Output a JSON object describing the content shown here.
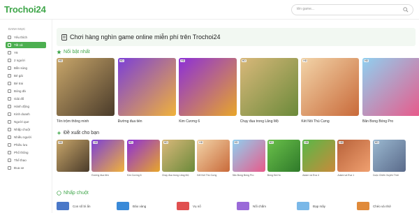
{
  "header": {
    "logo": "Trochoi24",
    "search_placeholder": "tên game..."
  },
  "sidebar": {
    "title": "DANH MỤC",
    "items": [
      {
        "label": "Yêu thích",
        "active": false
      },
      {
        "label": "Tất cả",
        "active": true
      },
      {
        "label": "Y8",
        "active": false
      },
      {
        "label": "2 người",
        "active": false
      },
      {
        "label": "Bắn súng",
        "active": false
      },
      {
        "label": "Bé gái",
        "active": false
      },
      {
        "label": "Bé trai",
        "active": false
      },
      {
        "label": "Bóng đá",
        "active": false
      },
      {
        "label": "Giải đố",
        "active": false
      },
      {
        "label": "Hành động",
        "active": false
      },
      {
        "label": "Kinh doanh",
        "active": false
      },
      {
        "label": "Người que",
        "active": false
      },
      {
        "label": "Nhấp chuột",
        "active": false
      },
      {
        "label": "Nhiều người",
        "active": false
      },
      {
        "label": "Phiêu lưu",
        "active": false
      },
      {
        "label": "Phổ thông",
        "active": false
      },
      {
        "label": "Thể thao",
        "active": false
      },
      {
        "label": "Đua xe",
        "active": false
      }
    ]
  },
  "banner": {
    "text": "Chơi hàng nghìn game online miễn phí trên Trochoi24"
  },
  "featured": {
    "title": "Nổi bật nhất",
    "games": [
      {
        "name": "Tên trộm thông minh",
        "tag": "HD",
        "colors": [
          "#c8a66a",
          "#4a3b2a"
        ]
      },
      {
        "name": "Đường đua tiền",
        "tag": "HD",
        "colors": [
          "#7b3fd8",
          "#f0b23a"
        ]
      },
      {
        "name": "Kim Cương 6",
        "tag": "HD",
        "colors": [
          "#8c2fd8",
          "#e8a62a"
        ]
      },
      {
        "name": "Chạy đua trong Lăng Mộ",
        "tag": "HD",
        "colors": [
          "#d9b87a",
          "#6b8a3a"
        ]
      },
      {
        "name": "Kết Nối Thú Cưng",
        "tag": "HD",
        "colors": [
          "#f2d4a8",
          "#c96a3a"
        ]
      },
      {
        "name": "Bắn Bong Bóng Pro",
        "tag": "HD",
        "colors": [
          "#8fd0f0",
          "#e85a8a"
        ]
      }
    ]
  },
  "suggested": {
    "title": "Đề xuất cho bạn",
    "games": [
      {
        "name": "",
        "tag": "HD",
        "colors": [
          "#c8a66a",
          "#4a3b2a"
        ]
      },
      {
        "name": "Đường đua tiền",
        "tag": "HD",
        "colors": [
          "#7b3fd8",
          "#f0b23a"
        ]
      },
      {
        "name": "Kim Cương 6",
        "tag": "HD",
        "colors": [
          "#8c2fd8",
          "#e8a62a"
        ]
      },
      {
        "name": "Chạy đua trong Lăng Mộ",
        "tag": "HD",
        "colors": [
          "#d9b87a",
          "#6b8a3a"
        ]
      },
      {
        "name": "Kết Nối Thú Cưng",
        "tag": "HD",
        "colors": [
          "#f2d4a8",
          "#c96a3a"
        ]
      },
      {
        "name": "Bắn Bong Bóng Pro",
        "tag": "HD",
        "colors": [
          "#8fd0f0",
          "#e85a8a"
        ]
      },
      {
        "name": "Bóng Đá Ho",
        "tag": "HD",
        "colors": [
          "#6ac04a",
          "#2f7a2a"
        ]
      },
      {
        "name": "Adam và Eva 4",
        "tag": "HD",
        "colors": [
          "#58b848",
          "#c98a3a"
        ]
      },
      {
        "name": "Adam và Eva 1",
        "tag": "HD",
        "colors": [
          "#b8623a",
          "#f0a070"
        ]
      },
      {
        "name": "Cuộc Chiến Xuyên Thời",
        "tag": "HD",
        "colors": [
          "#9ab8d0",
          "#5a6a8a"
        ]
      }
    ]
  },
  "clicker": {
    "title": "Nhấp chuột",
    "items": [
      {
        "label": "Con số bí ẩn",
        "color": "#4a78c8"
      },
      {
        "label": "Đảo vàng",
        "color": "#3a8ad8"
      },
      {
        "label": "Vụ nổ",
        "color": "#e05050"
      },
      {
        "label": "Nối chấm",
        "color": "#9a6ad8"
      },
      {
        "label": "Đạp mây",
        "color": "#7ab8e8"
      },
      {
        "label": "Chéo và nhớ",
        "color": "#e08a3a"
      }
    ]
  },
  "colors": {
    "brand": "#3fa64a",
    "active": "#4caf50",
    "banner_bg": "#f2f8f2"
  }
}
